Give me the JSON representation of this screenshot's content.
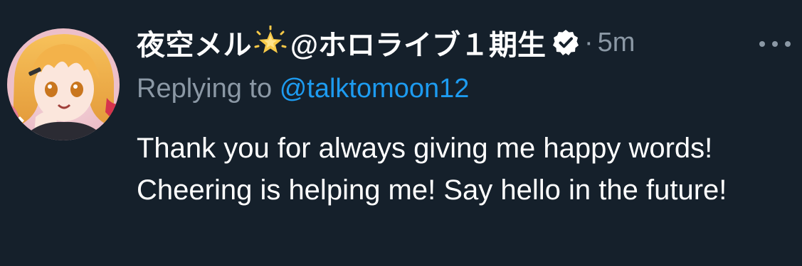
{
  "tweet": {
    "display_name": "夜空メル",
    "name_suffix": "@ホロライブ１期生",
    "separator": "·",
    "timestamp": "5m",
    "reply_prefix": "Replying to",
    "reply_to": "@talktomoon12",
    "text": "Thank you for always giving me happy words! Cheering is helping me! Say hello in the future!"
  },
  "icons": {
    "star": "sparkle-star-icon",
    "verified": "verified-badge-icon",
    "more": "more-options-icon"
  },
  "colors": {
    "background": "#15202b",
    "text_primary": "#ffffff",
    "text_secondary": "#8b98a5",
    "accent": "#1d9bf0"
  }
}
